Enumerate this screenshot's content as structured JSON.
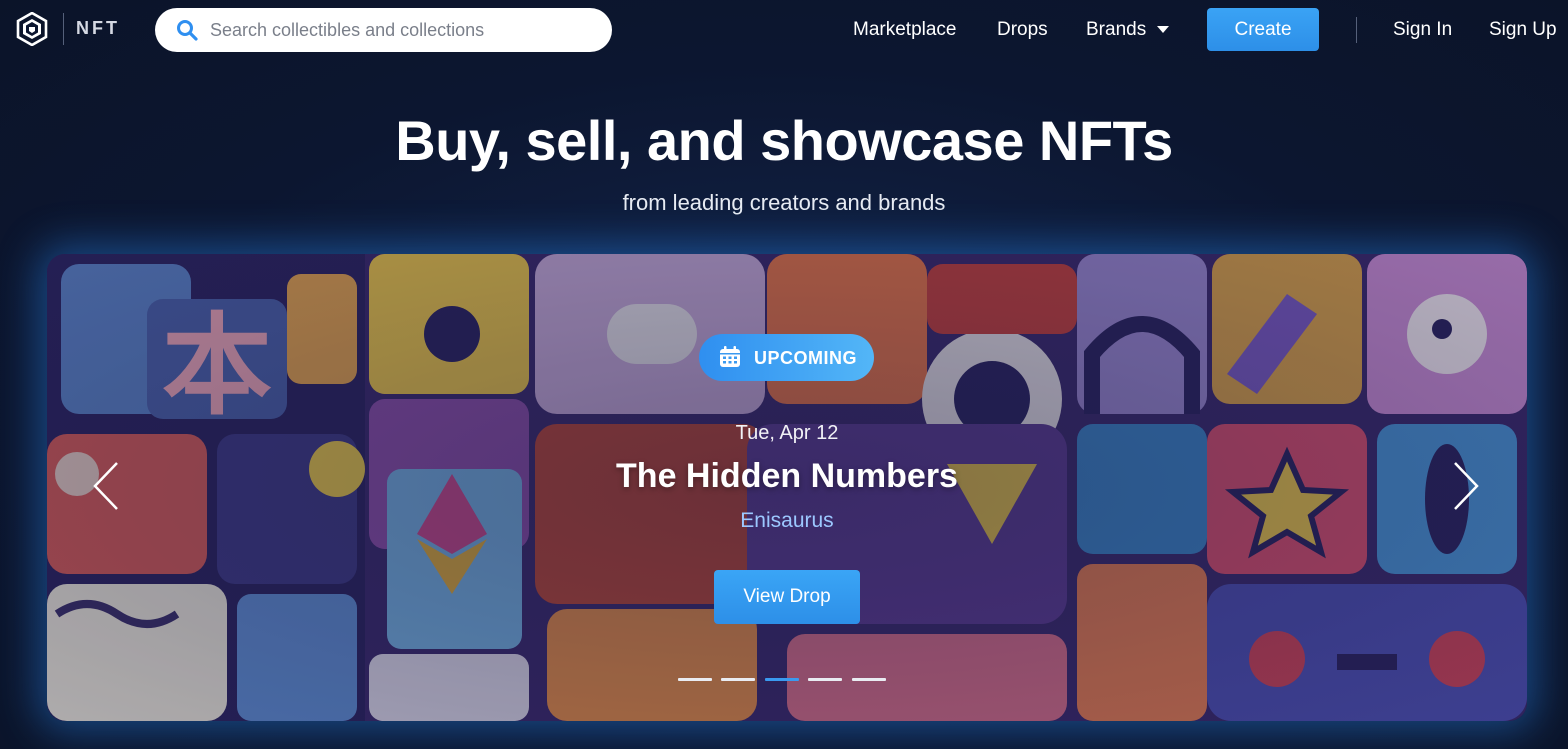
{
  "brand": {
    "logo_text": "NFT"
  },
  "search": {
    "placeholder": "Search collectibles and collections"
  },
  "nav": {
    "marketplace": "Marketplace",
    "drops": "Drops",
    "brands": "Brands",
    "create": "Create",
    "sign_in": "Sign In",
    "sign_up": "Sign Up"
  },
  "hero": {
    "title": "Buy, sell, and showcase NFTs",
    "subtitle": "from leading creators and brands"
  },
  "banner": {
    "badge": "UPCOMING",
    "date": "Tue, Apr 12",
    "title": "The Hidden Numbers",
    "creator": "Enisaurus",
    "cta": "View Drop",
    "slide_count": 5,
    "active_slide": 3
  },
  "colors": {
    "background": "#0c1630",
    "accent": "#3a9af0",
    "creator_text": "#9cc8ff"
  }
}
